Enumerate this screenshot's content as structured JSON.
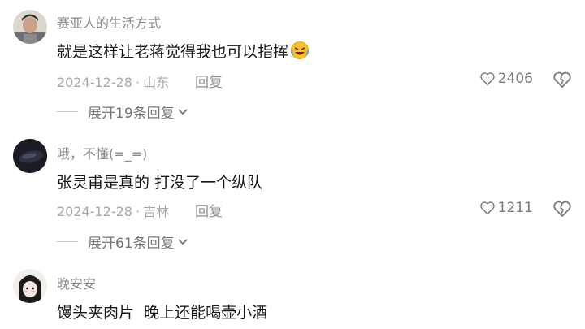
{
  "comments": [
    {
      "username": "赛亚人的生活方式",
      "text": "就是这样让老蒋觉得我也可以指挥",
      "emoji": "rolling-laughing-emoji",
      "date": "2024-12-28",
      "location": "山东",
      "reply_label": "回复",
      "likes": "2406",
      "expand_label": "展开19条回复"
    },
    {
      "username": "哦，不懂(=_=)",
      "text": "张灵甫是真的 打没了一个纵队",
      "date": "2024-12-28",
      "location": "吉林",
      "reply_label": "回复",
      "likes": "1211",
      "expand_label": "展开61条回复"
    },
    {
      "username": "晚安安",
      "text": "馒头夹肉片  晚上还能喝壶小酒"
    }
  ],
  "meta_separator": "·",
  "colors": {
    "username": "#8a8a8a",
    "meta": "#a8a8a8",
    "text": "#161616"
  }
}
